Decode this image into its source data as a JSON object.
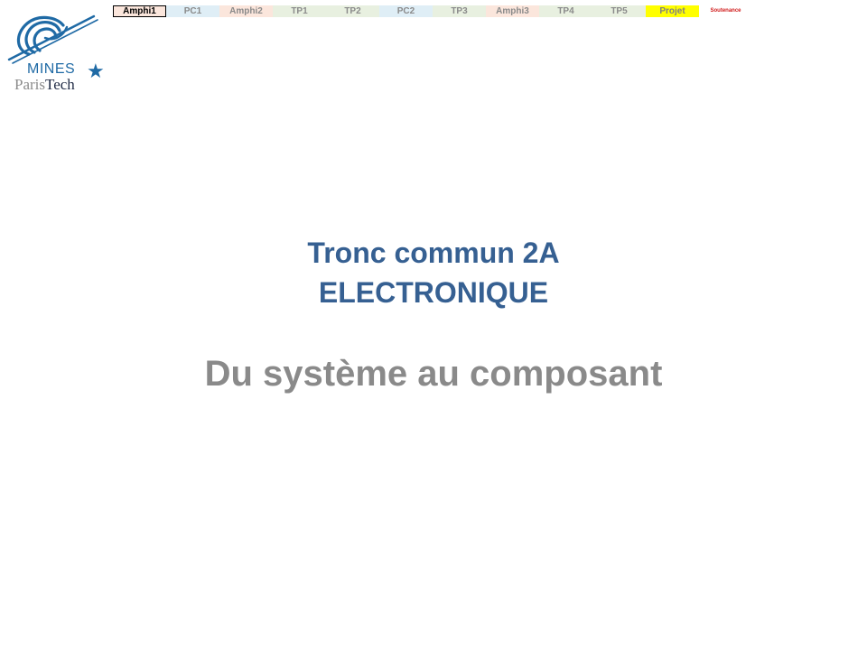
{
  "logo": {
    "name_top": "MINES",
    "name_bottom_part1": "Paris",
    "name_bottom_part2": "Tech",
    "star": "★",
    "brand_color": "#1f6aa5"
  },
  "nav": {
    "tabs": [
      {
        "label": "Amphi1",
        "kind": "amphi",
        "active": true
      },
      {
        "label": "PC1",
        "kind": "pc",
        "active": false
      },
      {
        "label": "Amphi2",
        "kind": "amphi",
        "active": false
      },
      {
        "label": "TP1",
        "kind": "tp",
        "active": false
      },
      {
        "label": "TP2",
        "kind": "tp",
        "active": false
      },
      {
        "label": "PC2",
        "kind": "pc",
        "active": false
      },
      {
        "label": "TP3",
        "kind": "tp",
        "active": false
      },
      {
        "label": "Amphi3",
        "kind": "amphi",
        "active": false
      },
      {
        "label": "TP4",
        "kind": "tp",
        "active": false
      },
      {
        "label": "TP5",
        "kind": "tp",
        "active": false
      },
      {
        "label": "Projet",
        "kind": "projet",
        "active": false
      },
      {
        "label": "Soutenance",
        "kind": "soutenance",
        "active": false
      }
    ],
    "colors": {
      "amphi": "#fbe6dc",
      "pc": "#dfeef6",
      "tp": "#e8f0e0",
      "projet": "#ffff00",
      "soutenance_text": "#d01a1a"
    }
  },
  "slide": {
    "title_line1": "Tronc commun 2A",
    "title_line2": "ELECTRONIQUE",
    "subtitle": "Du système au composant",
    "title_color": "#366092",
    "subtitle_color": "#8a8a8a"
  }
}
